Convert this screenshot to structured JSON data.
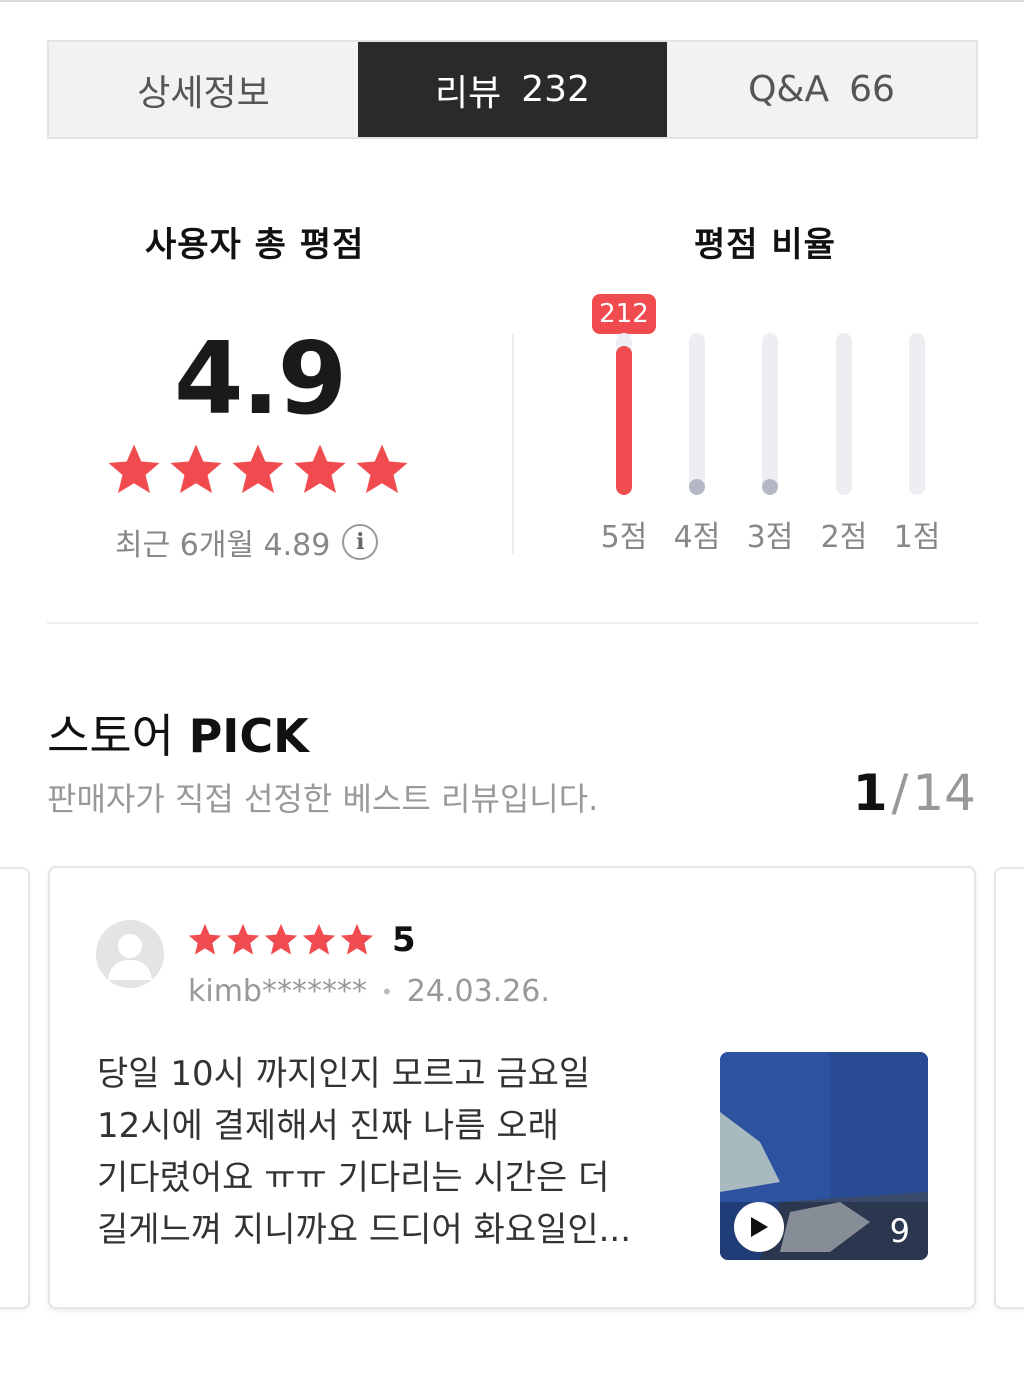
{
  "tabs": [
    {
      "label": "상세정보",
      "count": ""
    },
    {
      "label": "리뷰",
      "count": "232"
    },
    {
      "label": "Q&A",
      "count": "66"
    }
  ],
  "summary": {
    "title": "사용자 총 평점",
    "score": "4.9",
    "stars": 5,
    "recent_label": "최근 6개월 4.89",
    "info_icon": "info-icon"
  },
  "ratio": {
    "title": "평점 비율",
    "top_badge": "212",
    "bars": [
      {
        "label": "5점",
        "fraction": 0.92
      },
      {
        "label": "4점",
        "fraction": 0.05
      },
      {
        "label": "3점",
        "fraction": 0.04
      },
      {
        "label": "2점",
        "fraction": 0
      },
      {
        "label": "1점",
        "fraction": 0
      }
    ],
    "accent": "#f04b4f"
  },
  "pick": {
    "title_prefix": "스토어",
    "title_bold": "PICK",
    "subtitle": "판매자가 직접 선정한 베스트 리뷰입니다.",
    "current": "1",
    "separator": "/",
    "total": "14"
  },
  "review": {
    "stars": 5,
    "rating": "5",
    "user": "kimb*******",
    "date": "24.03.26.",
    "lines": [
      "당일 10시 까지인지 모르고 금요일",
      "12시에 결제해서 진짜 나름 오래",
      "기다렸어요 ㅠㅠ 기다리는 시간은 더",
      "길게느껴 지니까요 드디어 화요일인..."
    ],
    "media_count": "9"
  }
}
